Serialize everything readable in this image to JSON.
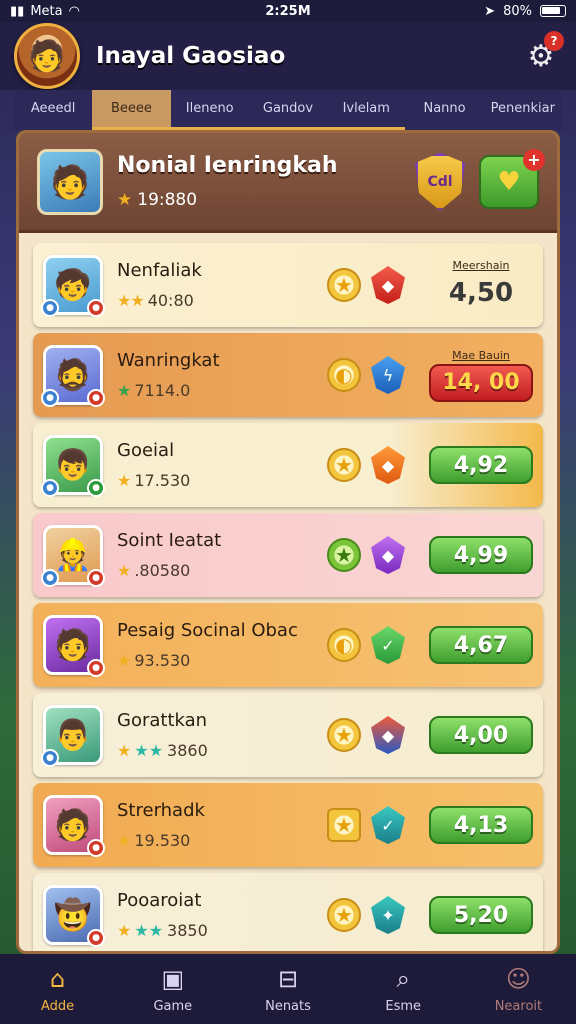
{
  "status": {
    "carrier": "Meta",
    "time": "2:25M",
    "battery": "80%"
  },
  "header": {
    "title": "Inayal Gaosiao",
    "notif_count": "?"
  },
  "tabs": [
    "Aeeedl",
    "Beeee",
    "Ilenenо",
    "Gandov",
    "Ivlelam",
    "Nanno",
    "Penenkiar"
  ],
  "panel": {
    "title": "Nonial Ienringkah",
    "score": "19:880",
    "shield_label": "Cdl",
    "button_plus": "+"
  },
  "rows": [
    {
      "name": "Nenfaliak",
      "score": "40:80",
      "label": "Meershain",
      "value": "4,50"
    },
    {
      "name": "Wanringkat",
      "score": "7114.0",
      "label": "Mae Bauin",
      "value": "14, 00"
    },
    {
      "name": "Goeial",
      "score": "17.530",
      "label": "",
      "value": "4,92"
    },
    {
      "name": "Soint Ieatat",
      "score": ".80580",
      "label": "",
      "value": "4,99"
    },
    {
      "name": "Pesaig Socinal Obac",
      "score": "93.530",
      "label": "",
      "value": "4,67"
    },
    {
      "name": "Gorattkan",
      "score": "3860",
      "label": "",
      "value": "4,00"
    },
    {
      "name": "Strerhadk",
      "score": "19.530",
      "label": "",
      "value": "4,13"
    },
    {
      "name": "Pooaroiat",
      "score": "3850",
      "label": "",
      "value": "5,20"
    }
  ],
  "nav": [
    "Adde",
    "Game",
    "Nenats",
    "Esme",
    "Nearoit"
  ],
  "icons": {
    "settings": "gear-icon",
    "star": "star-icon",
    "home": "home-icon",
    "game": "game-icon",
    "news": "news-icon",
    "search": "search-icon",
    "profile": "profile-icon"
  }
}
